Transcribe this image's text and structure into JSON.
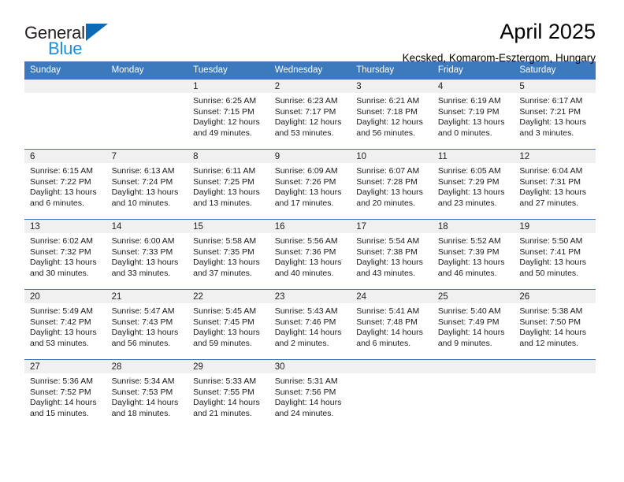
{
  "brand": {
    "name_part1": "General",
    "name_part2": "Blue",
    "triangle_icon": "triangle-icon",
    "primary_color": "#1b8fe0",
    "triangle_color": "#0a6ab5"
  },
  "header": {
    "title": "April 2025",
    "subtitle": "Kecsked, Komarom-Esztergom, Hungary"
  },
  "calendar": {
    "header_bg": "#3d79bd",
    "daynum_band_bg": "#f0f0f0",
    "weekday_headers": [
      "Sunday",
      "Monday",
      "Tuesday",
      "Wednesday",
      "Thursday",
      "Friday",
      "Saturday"
    ],
    "weeks": [
      [
        {
          "day": "",
          "sunrise": "",
          "sunset": "",
          "daylight_line1": "",
          "daylight_line2": ""
        },
        {
          "day": "",
          "sunrise": "",
          "sunset": "",
          "daylight_line1": "",
          "daylight_line2": ""
        },
        {
          "day": "1",
          "sunrise": "Sunrise: 6:25 AM",
          "sunset": "Sunset: 7:15 PM",
          "daylight_line1": "Daylight: 12 hours",
          "daylight_line2": "and 49 minutes."
        },
        {
          "day": "2",
          "sunrise": "Sunrise: 6:23 AM",
          "sunset": "Sunset: 7:17 PM",
          "daylight_line1": "Daylight: 12 hours",
          "daylight_line2": "and 53 minutes."
        },
        {
          "day": "3",
          "sunrise": "Sunrise: 6:21 AM",
          "sunset": "Sunset: 7:18 PM",
          "daylight_line1": "Daylight: 12 hours",
          "daylight_line2": "and 56 minutes."
        },
        {
          "day": "4",
          "sunrise": "Sunrise: 6:19 AM",
          "sunset": "Sunset: 7:19 PM",
          "daylight_line1": "Daylight: 13 hours",
          "daylight_line2": "and 0 minutes."
        },
        {
          "day": "5",
          "sunrise": "Sunrise: 6:17 AM",
          "sunset": "Sunset: 7:21 PM",
          "daylight_line1": "Daylight: 13 hours",
          "daylight_line2": "and 3 minutes."
        }
      ],
      [
        {
          "day": "6",
          "sunrise": "Sunrise: 6:15 AM",
          "sunset": "Sunset: 7:22 PM",
          "daylight_line1": "Daylight: 13 hours",
          "daylight_line2": "and 6 minutes."
        },
        {
          "day": "7",
          "sunrise": "Sunrise: 6:13 AM",
          "sunset": "Sunset: 7:24 PM",
          "daylight_line1": "Daylight: 13 hours",
          "daylight_line2": "and 10 minutes."
        },
        {
          "day": "8",
          "sunrise": "Sunrise: 6:11 AM",
          "sunset": "Sunset: 7:25 PM",
          "daylight_line1": "Daylight: 13 hours",
          "daylight_line2": "and 13 minutes."
        },
        {
          "day": "9",
          "sunrise": "Sunrise: 6:09 AM",
          "sunset": "Sunset: 7:26 PM",
          "daylight_line1": "Daylight: 13 hours",
          "daylight_line2": "and 17 minutes."
        },
        {
          "day": "10",
          "sunrise": "Sunrise: 6:07 AM",
          "sunset": "Sunset: 7:28 PM",
          "daylight_line1": "Daylight: 13 hours",
          "daylight_line2": "and 20 minutes."
        },
        {
          "day": "11",
          "sunrise": "Sunrise: 6:05 AM",
          "sunset": "Sunset: 7:29 PM",
          "daylight_line1": "Daylight: 13 hours",
          "daylight_line2": "and 23 minutes."
        },
        {
          "day": "12",
          "sunrise": "Sunrise: 6:04 AM",
          "sunset": "Sunset: 7:31 PM",
          "daylight_line1": "Daylight: 13 hours",
          "daylight_line2": "and 27 minutes."
        }
      ],
      [
        {
          "day": "13",
          "sunrise": "Sunrise: 6:02 AM",
          "sunset": "Sunset: 7:32 PM",
          "daylight_line1": "Daylight: 13 hours",
          "daylight_line2": "and 30 minutes."
        },
        {
          "day": "14",
          "sunrise": "Sunrise: 6:00 AM",
          "sunset": "Sunset: 7:33 PM",
          "daylight_line1": "Daylight: 13 hours",
          "daylight_line2": "and 33 minutes."
        },
        {
          "day": "15",
          "sunrise": "Sunrise: 5:58 AM",
          "sunset": "Sunset: 7:35 PM",
          "daylight_line1": "Daylight: 13 hours",
          "daylight_line2": "and 37 minutes."
        },
        {
          "day": "16",
          "sunrise": "Sunrise: 5:56 AM",
          "sunset": "Sunset: 7:36 PM",
          "daylight_line1": "Daylight: 13 hours",
          "daylight_line2": "and 40 minutes."
        },
        {
          "day": "17",
          "sunrise": "Sunrise: 5:54 AM",
          "sunset": "Sunset: 7:38 PM",
          "daylight_line1": "Daylight: 13 hours",
          "daylight_line2": "and 43 minutes."
        },
        {
          "day": "18",
          "sunrise": "Sunrise: 5:52 AM",
          "sunset": "Sunset: 7:39 PM",
          "daylight_line1": "Daylight: 13 hours",
          "daylight_line2": "and 46 minutes."
        },
        {
          "day": "19",
          "sunrise": "Sunrise: 5:50 AM",
          "sunset": "Sunset: 7:41 PM",
          "daylight_line1": "Daylight: 13 hours",
          "daylight_line2": "and 50 minutes."
        }
      ],
      [
        {
          "day": "20",
          "sunrise": "Sunrise: 5:49 AM",
          "sunset": "Sunset: 7:42 PM",
          "daylight_line1": "Daylight: 13 hours",
          "daylight_line2": "and 53 minutes."
        },
        {
          "day": "21",
          "sunrise": "Sunrise: 5:47 AM",
          "sunset": "Sunset: 7:43 PM",
          "daylight_line1": "Daylight: 13 hours",
          "daylight_line2": "and 56 minutes."
        },
        {
          "day": "22",
          "sunrise": "Sunrise: 5:45 AM",
          "sunset": "Sunset: 7:45 PM",
          "daylight_line1": "Daylight: 13 hours",
          "daylight_line2": "and 59 minutes."
        },
        {
          "day": "23",
          "sunrise": "Sunrise: 5:43 AM",
          "sunset": "Sunset: 7:46 PM",
          "daylight_line1": "Daylight: 14 hours",
          "daylight_line2": "and 2 minutes."
        },
        {
          "day": "24",
          "sunrise": "Sunrise: 5:41 AM",
          "sunset": "Sunset: 7:48 PM",
          "daylight_line1": "Daylight: 14 hours",
          "daylight_line2": "and 6 minutes."
        },
        {
          "day": "25",
          "sunrise": "Sunrise: 5:40 AM",
          "sunset": "Sunset: 7:49 PM",
          "daylight_line1": "Daylight: 14 hours",
          "daylight_line2": "and 9 minutes."
        },
        {
          "day": "26",
          "sunrise": "Sunrise: 5:38 AM",
          "sunset": "Sunset: 7:50 PM",
          "daylight_line1": "Daylight: 14 hours",
          "daylight_line2": "and 12 minutes."
        }
      ],
      [
        {
          "day": "27",
          "sunrise": "Sunrise: 5:36 AM",
          "sunset": "Sunset: 7:52 PM",
          "daylight_line1": "Daylight: 14 hours",
          "daylight_line2": "and 15 minutes."
        },
        {
          "day": "28",
          "sunrise": "Sunrise: 5:34 AM",
          "sunset": "Sunset: 7:53 PM",
          "daylight_line1": "Daylight: 14 hours",
          "daylight_line2": "and 18 minutes."
        },
        {
          "day": "29",
          "sunrise": "Sunrise: 5:33 AM",
          "sunset": "Sunset: 7:55 PM",
          "daylight_line1": "Daylight: 14 hours",
          "daylight_line2": "and 21 minutes."
        },
        {
          "day": "30",
          "sunrise": "Sunrise: 5:31 AM",
          "sunset": "Sunset: 7:56 PM",
          "daylight_line1": "Daylight: 14 hours",
          "daylight_line2": "and 24 minutes."
        },
        {
          "day": "",
          "sunrise": "",
          "sunset": "",
          "daylight_line1": "",
          "daylight_line2": ""
        },
        {
          "day": "",
          "sunrise": "",
          "sunset": "",
          "daylight_line1": "",
          "daylight_line2": ""
        },
        {
          "day": "",
          "sunrise": "",
          "sunset": "",
          "daylight_line1": "",
          "daylight_line2": ""
        }
      ]
    ]
  }
}
